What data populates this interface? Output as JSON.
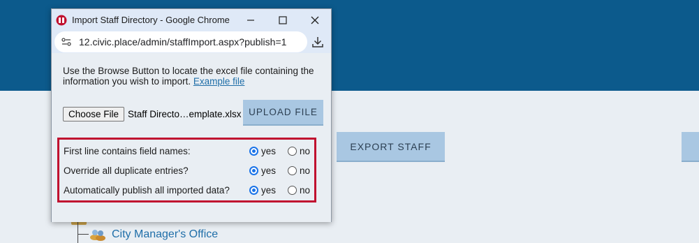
{
  "window": {
    "title": "Import Staff Directory - Google Chrome",
    "url": "12.civic.place/admin/staffImport.aspx?publish=1"
  },
  "content": {
    "intro_text": "Use the Browse Button to locate the excel file containing the information you wish to import.",
    "example_link": "Example file",
    "choose_file_label": "Choose File",
    "selected_file": "Staff Directo…emplate.xlsx",
    "upload_label": "UPLOAD FILE"
  },
  "options": [
    {
      "label": "First line contains field names:",
      "yes": "yes",
      "no": "no",
      "selected": "yes"
    },
    {
      "label": "Override all duplicate entries?",
      "yes": "yes",
      "no": "no",
      "selected": "yes"
    },
    {
      "label": "Automatically publish all imported data?",
      "yes": "yes",
      "no": "no",
      "selected": "yes"
    }
  ],
  "background": {
    "export_label": "EXPORT STAFF",
    "tree_item": "City Manager's Office"
  },
  "colors": {
    "header_blue": "#0c5a8c",
    "button_blue": "#a9c7e2",
    "highlight_red": "#c0102f",
    "link_blue": "#1f6ea8"
  }
}
